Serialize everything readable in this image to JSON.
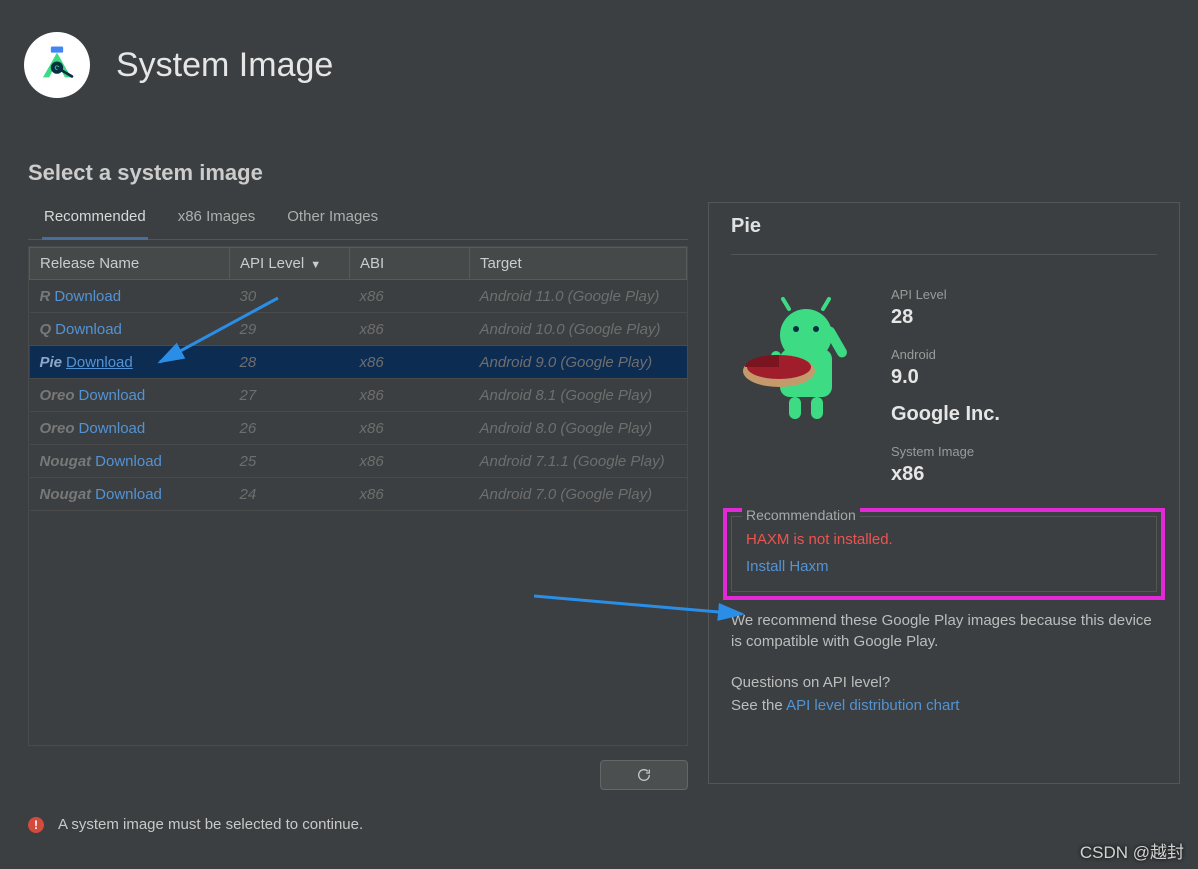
{
  "header": {
    "title": "System Image"
  },
  "subtitle": "Select a system image",
  "tabs": {
    "recommended": "Recommended",
    "x86": "x86 Images",
    "other": "Other Images"
  },
  "columns": {
    "release": "Release Name",
    "api": "API Level",
    "abi": "ABI",
    "target": "Target"
  },
  "download_label": "Download",
  "rows": [
    {
      "name": "R",
      "api": "30",
      "abi": "x86",
      "target": "Android 11.0 (Google Play)"
    },
    {
      "name": "Q",
      "api": "29",
      "abi": "x86",
      "target": "Android 10.0 (Google Play)"
    },
    {
      "name": "Pie",
      "api": "28",
      "abi": "x86",
      "target": "Android 9.0 (Google Play)"
    },
    {
      "name": "Oreo",
      "api": "27",
      "abi": "x86",
      "target": "Android 8.1 (Google Play)"
    },
    {
      "name": "Oreo",
      "api": "26",
      "abi": "x86",
      "target": "Android 8.0 (Google Play)"
    },
    {
      "name": "Nougat",
      "api": "25",
      "abi": "x86",
      "target": "Android 7.1.1 (Google Play)"
    },
    {
      "name": "Nougat",
      "api": "24",
      "abi": "x86",
      "target": "Android 7.0 (Google Play)"
    }
  ],
  "detail": {
    "title": "Pie",
    "api_label": "API Level",
    "api_value": "28",
    "android_label": "Android",
    "android_value": "9.0",
    "vendor": "Google Inc.",
    "si_label": "System Image",
    "si_value": "x86"
  },
  "recommendation": {
    "legend": "Recommendation",
    "warn": "HAXM is not installed.",
    "install_link": "Install Haxm",
    "note": "We recommend these Google Play images because this device is compatible with Google Play.",
    "question": "Questions on API level?",
    "see_the": "See the ",
    "chart_link": "API level distribution chart"
  },
  "footer_error": "A system image must be selected to continue.",
  "watermark": "CSDN @越封"
}
